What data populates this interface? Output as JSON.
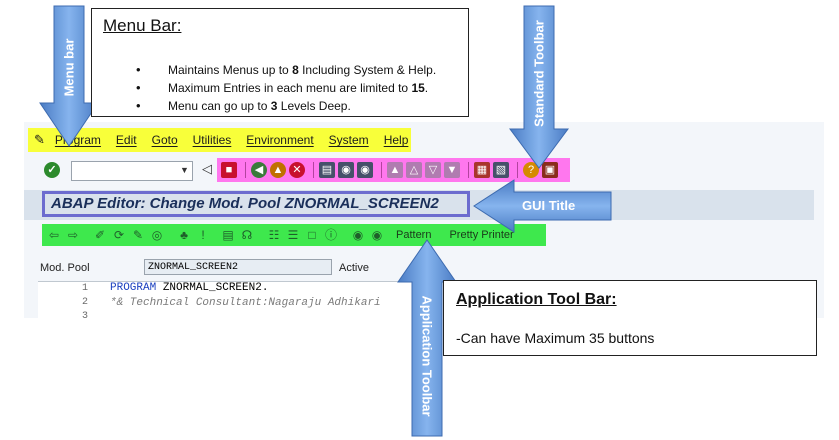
{
  "menu_bar": {
    "items": [
      "Program",
      "Edit",
      "Goto",
      "Utilities",
      "Environment",
      "System",
      "Help"
    ]
  },
  "screen": {
    "title": "ABAP Editor: Change Mod. Pool ZNORMAL_SCREEN2"
  },
  "app_toolbar": {
    "pattern_label": "Pattern",
    "pretty_printer_label": "Pretty Printer"
  },
  "field": {
    "label": "Mod. Pool",
    "value": "ZNORMAL_SCREEN2",
    "status": "Active"
  },
  "editor": {
    "lines": [
      {
        "no": "1",
        "kw": "PROGRAM",
        "text": " ZNORMAL_SCREEN2."
      },
      {
        "no": "2",
        "comment": "*& Technical Consultant:Nagaraju Adhikari"
      },
      {
        "no": "3"
      }
    ]
  },
  "annotations": {
    "menu_bar_label": "Menu bar",
    "standard_toolbar_label": "Standard Toolbar",
    "gui_title_label": "GUI Title",
    "application_toolbar_label": "Application Toolbar",
    "menu_callout": {
      "title": "Menu Bar:",
      "bullets": [
        {
          "pre": "Maintains Menus up to ",
          "num": "8",
          "post": " Including System & Help."
        },
        {
          "pre": "Maximum Entries in each menu are limited to ",
          "num": "15",
          "post": "."
        },
        {
          "pre": "Menu can go up to ",
          "num": "3",
          "post": " Levels Deep."
        }
      ]
    },
    "app_callout": {
      "title": "Application Tool Bar:",
      "body": "-Can have Maximum 35 buttons"
    }
  },
  "colors": {
    "menu_highlight": "#f8ff3a",
    "standard_toolbar_highlight": "#ff77ee",
    "app_toolbar_highlight": "#3ee84d",
    "arrow_blue": "#5b8fd6",
    "title_border": "#6c6ccf"
  }
}
